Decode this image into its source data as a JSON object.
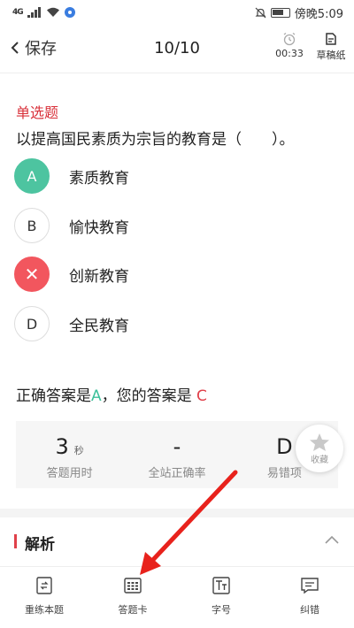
{
  "status_bar": {
    "signal": "4G",
    "time": "傍晚5:09"
  },
  "nav": {
    "back_label": "保存",
    "title": "10/10",
    "timer": "00:33",
    "draft_label": "草稿纸"
  },
  "question": {
    "type": "单选题",
    "text": "以提高国民素质为宗旨的教育是（　　）。",
    "options": [
      {
        "key": "A",
        "label": "素质教育",
        "state": "correct"
      },
      {
        "key": "B",
        "label": "愉快教育",
        "state": "normal"
      },
      {
        "key": "C",
        "label": "创新教育",
        "state": "wrong",
        "mark": "✕"
      },
      {
        "key": "D",
        "label": "全民教育",
        "state": "normal"
      }
    ]
  },
  "answer": {
    "prefix": "正确答案是",
    "correct": "A",
    "middle": "，您的答案是 ",
    "user": "C"
  },
  "stats": [
    {
      "value": "3",
      "unit": "秒",
      "label": "答题用时"
    },
    {
      "value": "-",
      "unit": "",
      "label": "全站正确率"
    },
    {
      "value": "D",
      "unit": "",
      "label": "易错项"
    }
  ],
  "favorite_label": "收藏",
  "analysis_title": "解析",
  "toolbar": [
    {
      "label": "重练本题",
      "icon": "redo-icon"
    },
    {
      "label": "答题卡",
      "icon": "answer-card-icon"
    },
    {
      "label": "字号",
      "icon": "font-size-icon"
    },
    {
      "label": "纠错",
      "icon": "feedback-icon"
    }
  ],
  "colors": {
    "accent_red": "#e0404a",
    "correct_green": "#4dc4a0",
    "wrong_red": "#f2565e"
  }
}
